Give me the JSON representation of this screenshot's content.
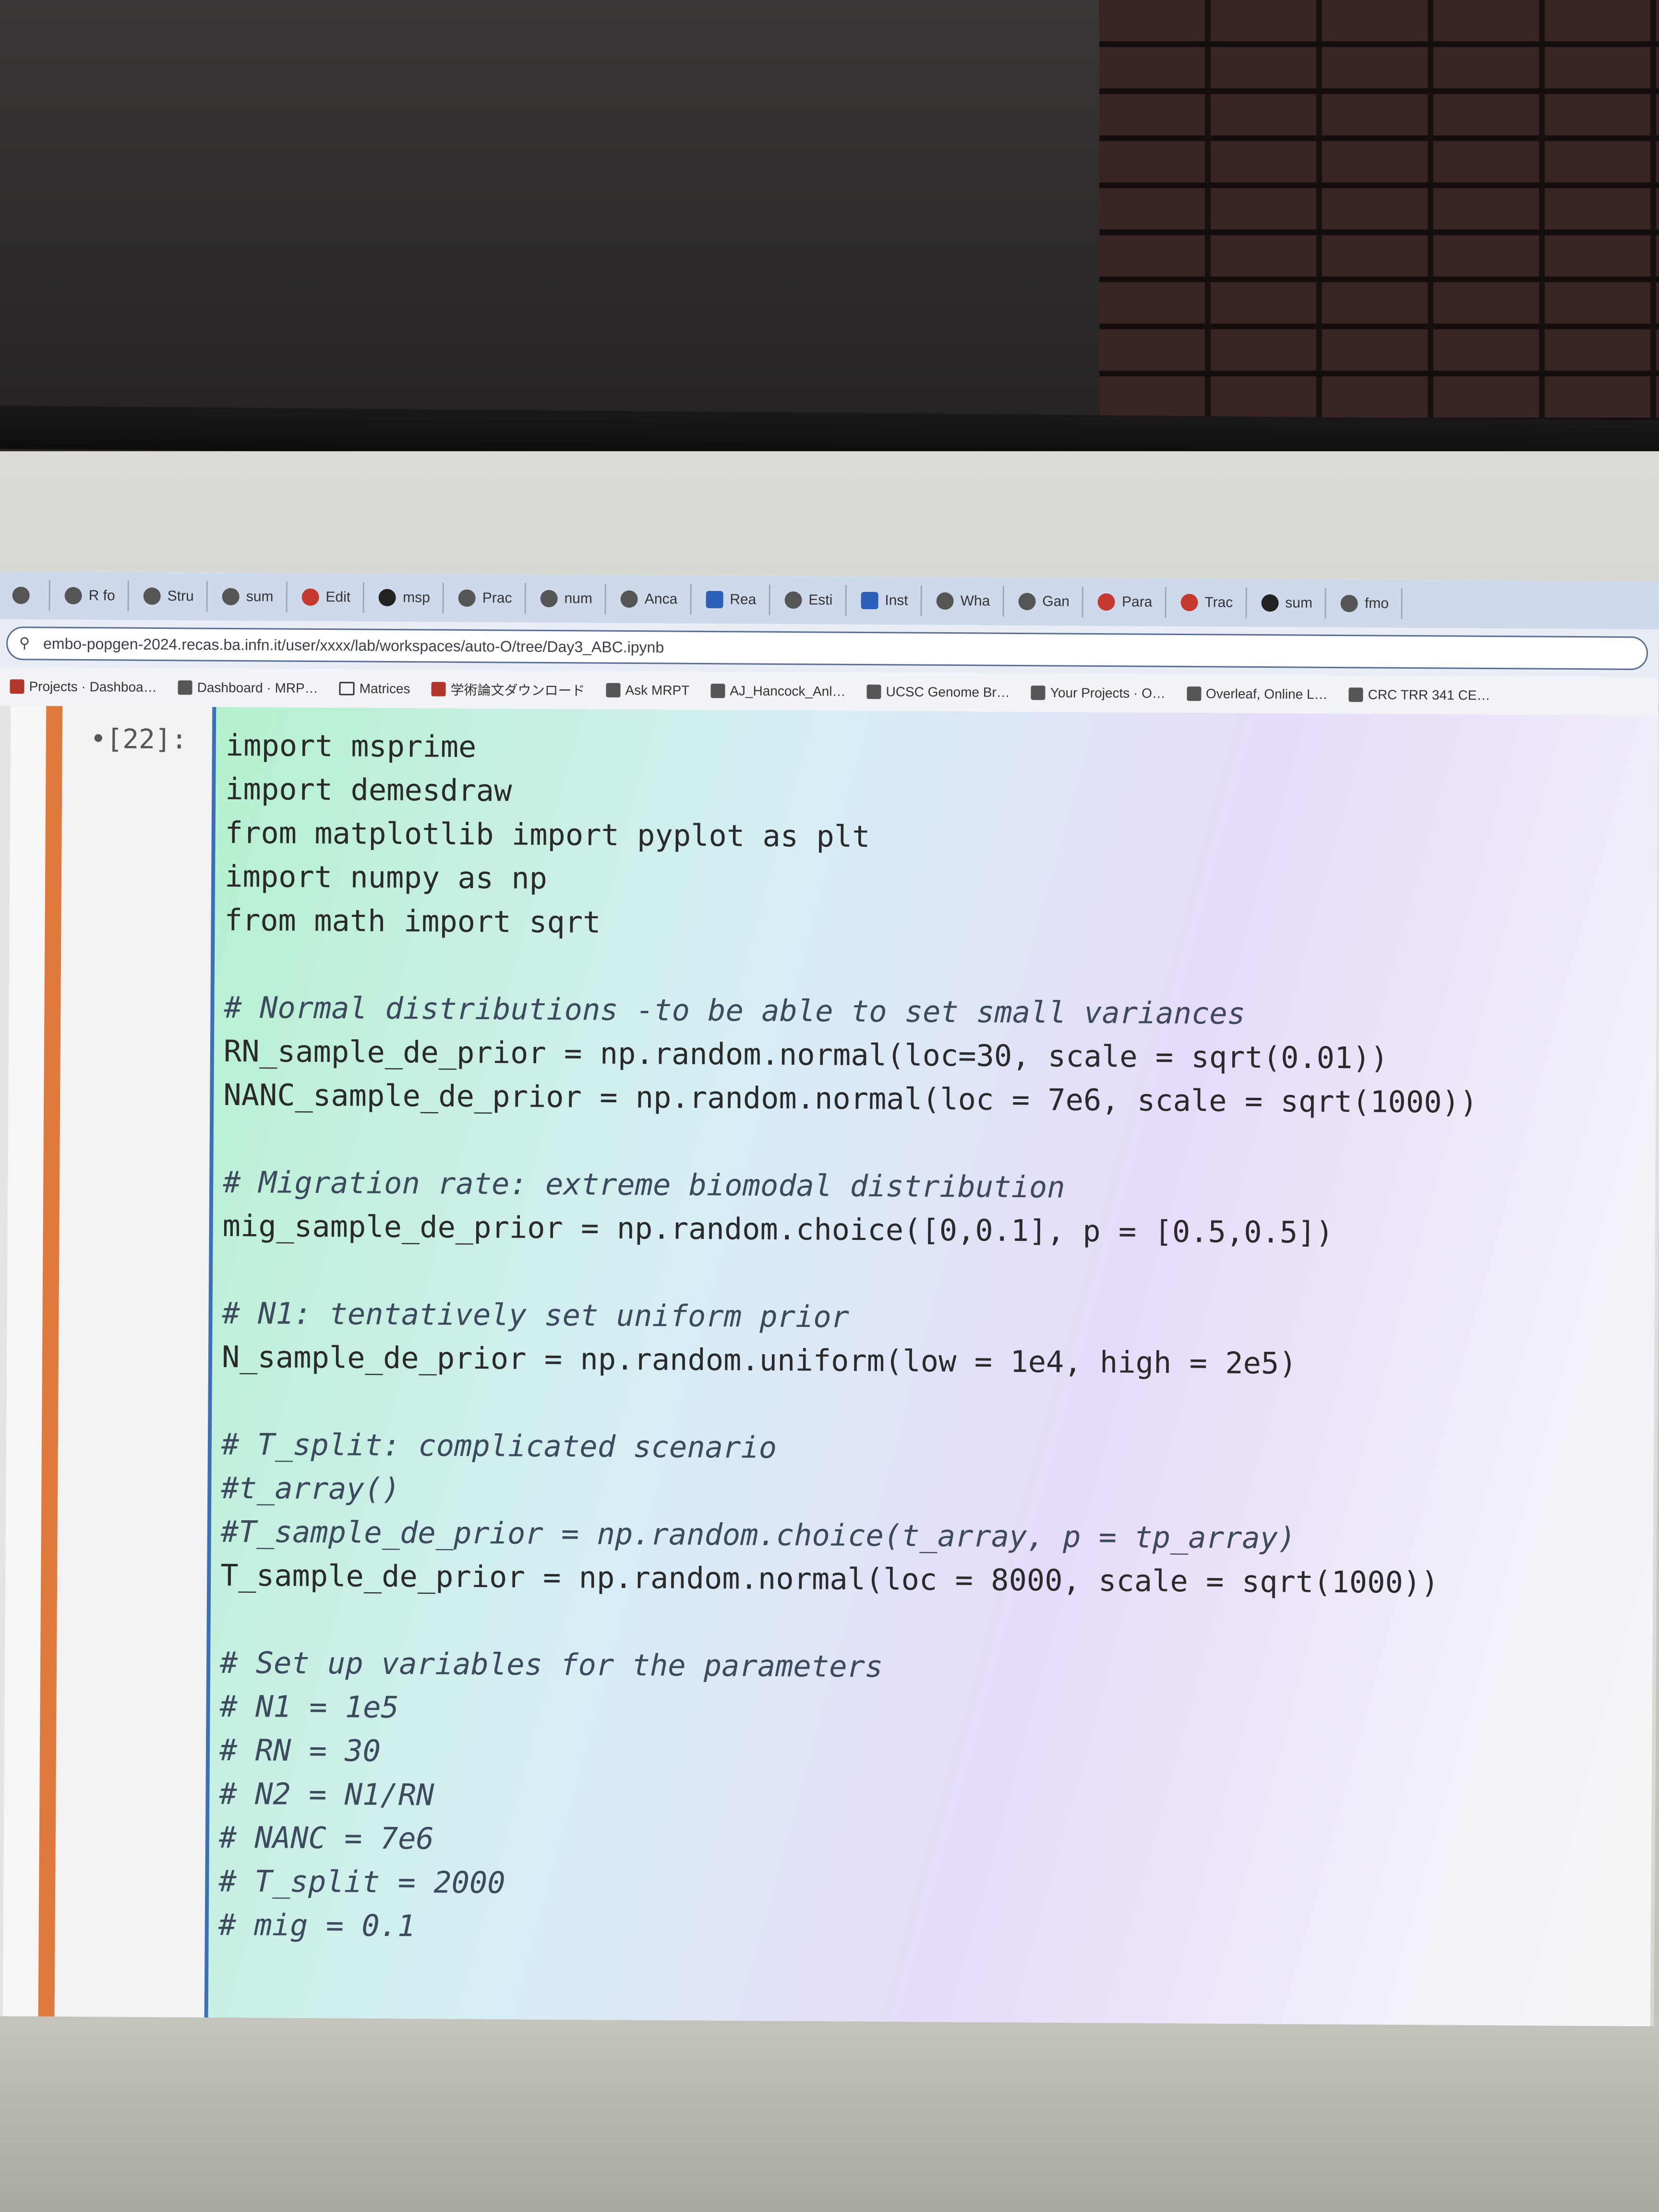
{
  "browser": {
    "tabs": [
      {
        "label": "",
        "icon": "tab-icon"
      },
      {
        "label": "R fo",
        "icon": "tab-icon"
      },
      {
        "label": "Stru",
        "icon": "tab-icon"
      },
      {
        "label": "sum",
        "icon": "tab-icon"
      },
      {
        "label": "Edit",
        "icon": "tab-icon"
      },
      {
        "label": "msp",
        "icon": "github-icon"
      },
      {
        "label": "Prac",
        "icon": "tab-icon"
      },
      {
        "label": "num",
        "icon": "tab-icon"
      },
      {
        "label": "Anca",
        "icon": "tab-icon"
      },
      {
        "label": "Rea",
        "icon": "tab-icon"
      },
      {
        "label": "Esti",
        "icon": "tab-icon"
      },
      {
        "label": "Inst",
        "icon": "tab-icon"
      },
      {
        "label": "Wha",
        "icon": "tab-icon"
      },
      {
        "label": "Gan",
        "icon": "tab-icon"
      },
      {
        "label": "Para",
        "icon": "tab-icon"
      },
      {
        "label": "Trac",
        "icon": "tab-icon"
      },
      {
        "label": "sum",
        "icon": "github-icon"
      },
      {
        "label": "fmo",
        "icon": "tab-icon"
      }
    ],
    "url": "embo-popgen-2024.recas.ba.infn.it/user/xxxx/lab/workspaces/auto-O/tree/Day3_ABC.ipynb",
    "bookmarks": [
      {
        "label": "Projects · Dashboa…"
      },
      {
        "label": "Dashboard · MRP…"
      },
      {
        "label": "Matrices"
      },
      {
        "label": "学術論文ダウンロード"
      },
      {
        "label": "Ask MRPT"
      },
      {
        "label": "AJ_Hancock_Anl…"
      },
      {
        "label": "UCSC Genome Br…"
      },
      {
        "label": "Your Projects · O…"
      },
      {
        "label": "Overleaf, Online L…"
      },
      {
        "label": "CRC TRR 341 CE…"
      }
    ]
  },
  "notebook": {
    "cell_prompt": "[22]:",
    "collapse_marker": "•",
    "code_lines": [
      "import msprime",
      "import demesdraw",
      "from matplotlib import pyplot as plt",
      "import numpy as np",
      "from math import sqrt",
      "",
      "# Normal distributions -to be able to set small variances",
      "RN_sample_de_prior = np.random.normal(loc=30, scale = sqrt(0.01))",
      "NANC_sample_de_prior = np.random.normal(loc = 7e6, scale = sqrt(1000))",
      "",
      "# Migration rate: extreme biomodal distribution",
      "mig_sample_de_prior = np.random.choice([0,0.1], p = [0.5,0.5])",
      "",
      "# N1: tentatively set uniform prior",
      "N_sample_de_prior = np.random.uniform(low = 1e4, high = 2e5)",
      "",
      "# T_split: complicated scenario",
      "#t_array()",
      "#T_sample_de_prior = np.random.choice(t_array, p = tp_array)",
      "T_sample_de_prior = np.random.normal(loc = 8000, scale = sqrt(1000))",
      "",
      "# Set up variables for the parameters",
      "# N1 = 1e5",
      "# RN = 30",
      "# N2 = N1/RN",
      "# NANC = 7e6",
      "# T_split = 2000",
      "# mig = 0.1"
    ]
  }
}
